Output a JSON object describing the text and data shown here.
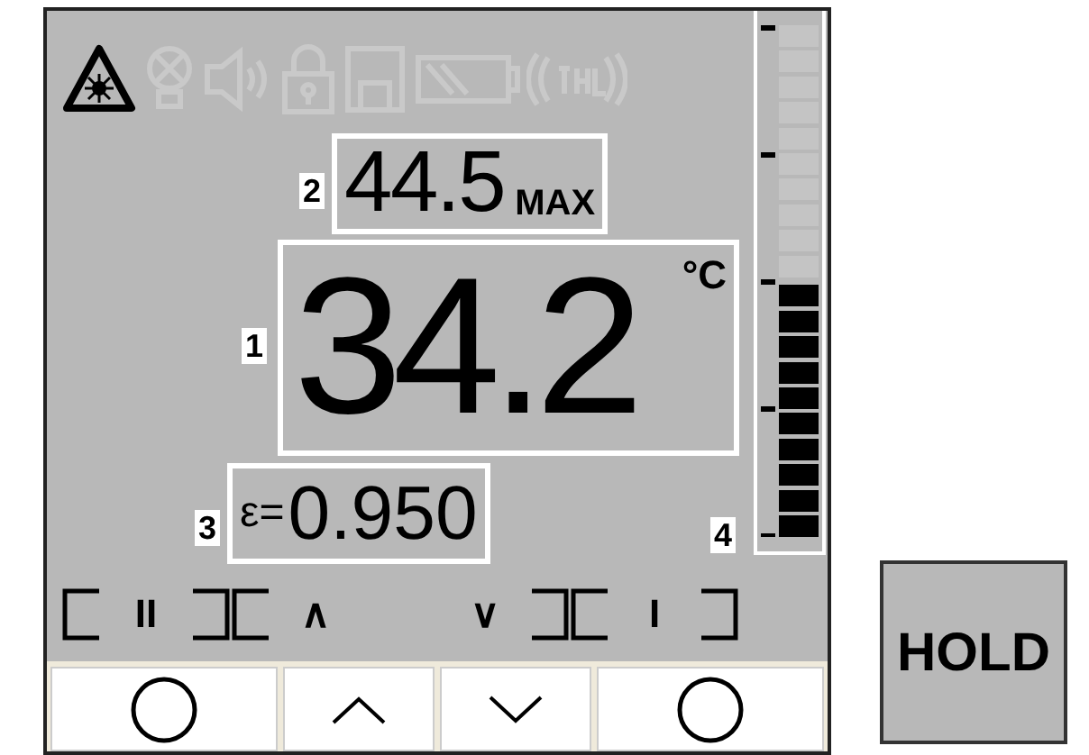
{
  "status_icons": [
    {
      "kind": "laser",
      "lit": true
    },
    {
      "kind": "bulb",
      "lit": false
    },
    {
      "kind": "speaker",
      "lit": false
    },
    {
      "kind": "lock",
      "lit": false
    },
    {
      "kind": "memory",
      "lit": false
    },
    {
      "kind": "battery",
      "lit": false
    },
    {
      "kind": "signal",
      "lit": false
    }
  ],
  "secondary": {
    "callout": "2",
    "value": "44.5",
    "mode": "MAX"
  },
  "primary": {
    "callout": "1",
    "value": "34.2",
    "unit": "°C"
  },
  "emissivity": {
    "callout": "3",
    "label": "ε=",
    "value": "0.950"
  },
  "bargraph": {
    "callout": "4",
    "level": 0.5
  },
  "softkeys": [
    {
      "label": "II",
      "left_bracket": true,
      "right_bracket": true
    },
    {
      "label": "∧",
      "left_bracket": true,
      "right_bracket": false
    },
    {
      "label": "∨",
      "left_bracket": false,
      "right_bracket": true
    },
    {
      "label": "I",
      "left_bracket": true,
      "right_bracket": true
    }
  ],
  "buttons": [
    {
      "kind": "circle"
    },
    {
      "kind": "up"
    },
    {
      "kind": "down"
    },
    {
      "kind": "circle"
    }
  ],
  "hold_button": {
    "label": "HOLD"
  }
}
